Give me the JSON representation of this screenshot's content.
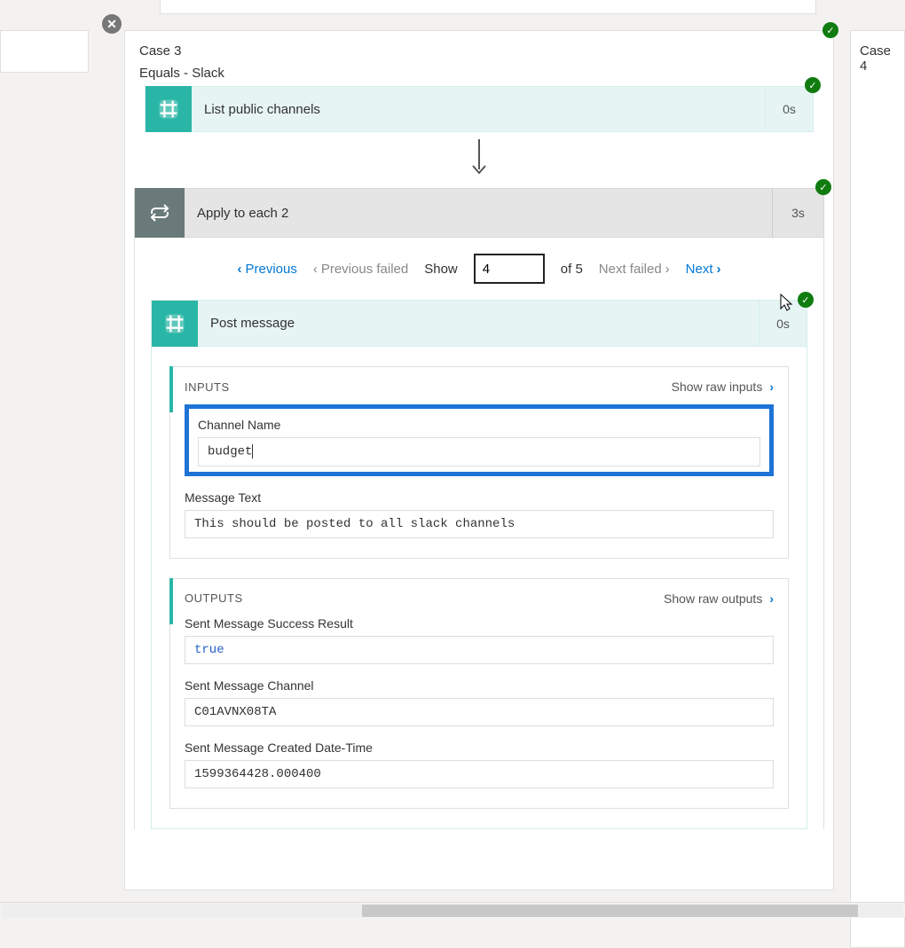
{
  "top_stub": "",
  "left_stub": "",
  "right_stub": {
    "label": "Case 4"
  },
  "case": {
    "title": "Case 3",
    "subtitle": "Equals - Slack"
  },
  "actions": {
    "list_channels": {
      "label": "List public channels",
      "duration": "0s"
    },
    "apply_each": {
      "label": "Apply to each 2",
      "duration": "3s"
    },
    "post_message": {
      "label": "Post message",
      "duration": "0s"
    }
  },
  "pager": {
    "previous": "Previous",
    "previous_failed": "Previous failed",
    "show_label": "Show",
    "current": "4",
    "of_label": "of 5",
    "next_failed": "Next failed",
    "next": "Next"
  },
  "inputs": {
    "title": "INPUTS",
    "raw_link": "Show raw inputs",
    "channel_name_label": "Channel Name",
    "channel_name_value": "budget",
    "message_text_label": "Message Text",
    "message_text_value": "This should be posted to all slack channels"
  },
  "outputs": {
    "title": "OUTPUTS",
    "raw_link": "Show raw outputs",
    "success_label": "Sent Message Success Result",
    "success_value": "true",
    "channel_label": "Sent Message Channel",
    "channel_value": "C01AVNX08TA",
    "created_label": "Sent Message Created Date-Time",
    "created_value": "1599364428.000400"
  }
}
